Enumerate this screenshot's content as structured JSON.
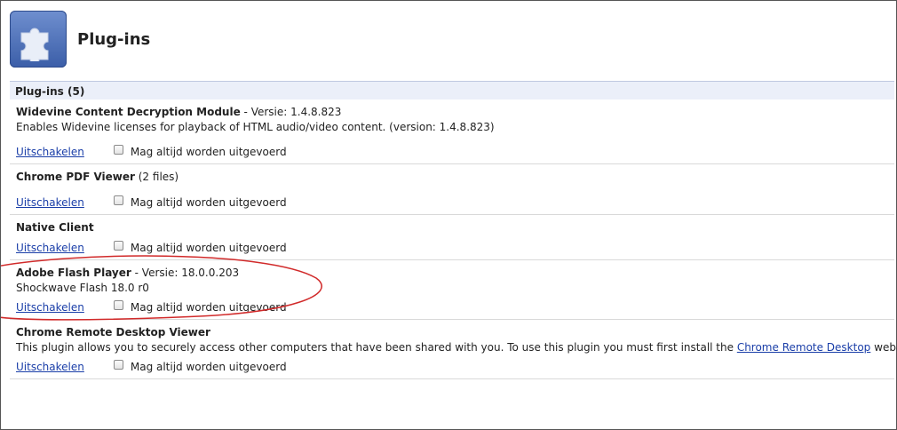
{
  "page": {
    "title": "Plug-ins",
    "section_label": "Plug-ins (5)"
  },
  "strings": {
    "disable_label": "Uitschakelen",
    "always_allowed_label": "Mag altijd worden uitgevoerd"
  },
  "plugins": [
    {
      "name": "Widevine Content Decryption Module",
      "version_text": " - Versie: 1.4.8.823",
      "description": "Enables Widevine licenses for playback of HTML audio/video content. (version: 1.4.8.823)"
    },
    {
      "name": "Chrome PDF Viewer",
      "version_text": " (2 files)",
      "description": ""
    },
    {
      "name": "Native Client",
      "version_text": "",
      "description": ""
    },
    {
      "name": "Adobe Flash Player",
      "version_text": " - Versie: 18.0.0.203",
      "description": "Shockwave Flash 18.0 r0"
    },
    {
      "name": "Chrome Remote Desktop Viewer",
      "version_text": "",
      "description_before": "This plugin allows you to securely access other computers that have been shared with you. To use this plugin you must first install the ",
      "description_link": "Chrome Remote Desktop",
      "description_after": " webapp."
    }
  ],
  "colors": {
    "link": "#1a3ea8",
    "section_bg": "#ebeff9",
    "annotation": "#d12a2a"
  },
  "icons": {
    "app_logo": "puzzle-piece-icon"
  }
}
